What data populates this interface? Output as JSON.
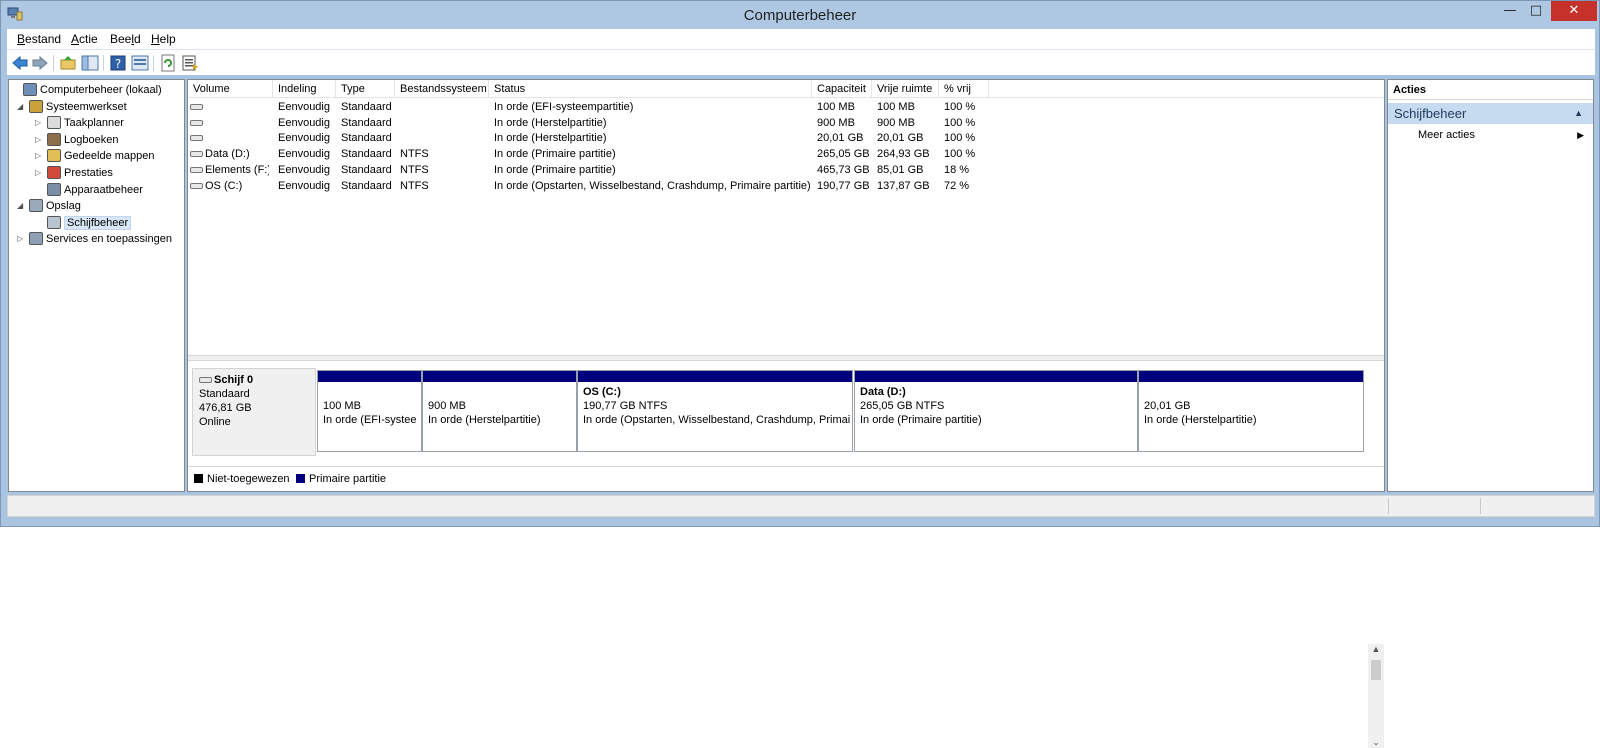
{
  "window": {
    "title": "Computerbeheer"
  },
  "menu": [
    {
      "label": "Bestand"
    },
    {
      "label": "Actie"
    },
    {
      "label": "Beeld"
    },
    {
      "label": "Help"
    }
  ],
  "toolbar_icons": [
    "back-arrow-icon",
    "forward-arrow-icon",
    "folder-up-icon",
    "show-hide-tree-icon",
    "help-icon",
    "properties-icon",
    "refresh-icon",
    "export-list-icon"
  ],
  "tree": [
    {
      "label": "Computerbeheer (lokaal)",
      "icon": "computer-management-icon",
      "level": 0,
      "expander": ""
    },
    {
      "label": "Systeemwerkset",
      "icon": "tools-icon",
      "level": 1,
      "expander": "◢"
    },
    {
      "label": "Taakplanner",
      "icon": "clock-icon",
      "level": 2,
      "expander": "▷"
    },
    {
      "label": "Logboeken",
      "icon": "event-log-icon",
      "level": 2,
      "expander": "▷"
    },
    {
      "label": "Gedeelde mappen",
      "icon": "shared-folder-icon",
      "level": 2,
      "expander": "▷"
    },
    {
      "label": "Prestaties",
      "icon": "performance-icon",
      "level": 2,
      "expander": "▷"
    },
    {
      "label": "Apparaatbeheer",
      "icon": "device-manager-icon",
      "level": 2,
      "expander": ""
    },
    {
      "label": "Opslag",
      "icon": "storage-icon",
      "level": 1,
      "expander": "◢"
    },
    {
      "label": "Schijfbeheer",
      "icon": "disk-management-icon",
      "level": 2,
      "expander": "",
      "selected": true
    },
    {
      "label": "Services en toepassingen",
      "icon": "services-icon",
      "level": 1,
      "expander": "▷"
    }
  ],
  "volumes": {
    "columns": [
      "Volume",
      "Indeling",
      "Type",
      "Bestandssysteem",
      "Status",
      "Capaciteit",
      "Vrije ruimte",
      "% vrij"
    ],
    "rows": [
      [
        "",
        "Eenvoudig",
        "Standaard",
        "",
        "In orde (EFI-systeempartitie)",
        "100 MB",
        "100 MB",
        "100 %"
      ],
      [
        "",
        "Eenvoudig",
        "Standaard",
        "",
        "In orde (Herstelpartitie)",
        "900 MB",
        "900 MB",
        "100 %"
      ],
      [
        "",
        "Eenvoudig",
        "Standaard",
        "",
        "In orde (Herstelpartitie)",
        "20,01 GB",
        "20,01 GB",
        "100 %"
      ],
      [
        "Data (D:)",
        "Eenvoudig",
        "Standaard",
        "NTFS",
        "In orde (Primaire partitie)",
        "265,05 GB",
        "264,93 GB",
        "100 %"
      ],
      [
        "Elements (F:)",
        "Eenvoudig",
        "Standaard",
        "NTFS",
        "In orde (Primaire partitie)",
        "465,73 GB",
        "85,01 GB",
        "18 %"
      ],
      [
        "OS (C:)",
        "Eenvoudig",
        "Standaard",
        "NTFS",
        "In orde (Opstarten, Wisselbestand, Crashdump, Primaire partitie)",
        "190,77 GB",
        "137,87 GB",
        "72 %"
      ]
    ]
  },
  "disk": {
    "name": "Schijf 0",
    "type": "Standaard",
    "size": "476,81 GB",
    "state": "Online",
    "partitions": [
      {
        "name": "",
        "size": "100 MB",
        "status": "In orde (EFI-systee"
      },
      {
        "name": "",
        "size": "900 MB",
        "status": "In orde (Herstelpartitie)"
      },
      {
        "name": "OS  (C:)",
        "size": "190,77 GB NTFS",
        "status": "In orde (Opstarten, Wisselbestand, Crashdump, Primai"
      },
      {
        "name": "Data  (D:)",
        "size": "265,05 GB NTFS",
        "status": "In orde (Primaire partitie)"
      },
      {
        "name": "",
        "size": "20,01 GB",
        "status": "In orde (Herstelpartitie)"
      }
    ]
  },
  "legend": [
    {
      "label": "Niet-toegewezen",
      "color": "#000000"
    },
    {
      "label": "Primaire partitie",
      "color": "#00007f"
    }
  ],
  "actions": {
    "header": "Acties",
    "section": "Schijfbeheer",
    "items": [
      {
        "label": "Meer acties"
      }
    ]
  },
  "colors": {
    "partition_bar": "#00007f",
    "titlebar": "#aec8e3",
    "close_button": "#c7312b"
  }
}
